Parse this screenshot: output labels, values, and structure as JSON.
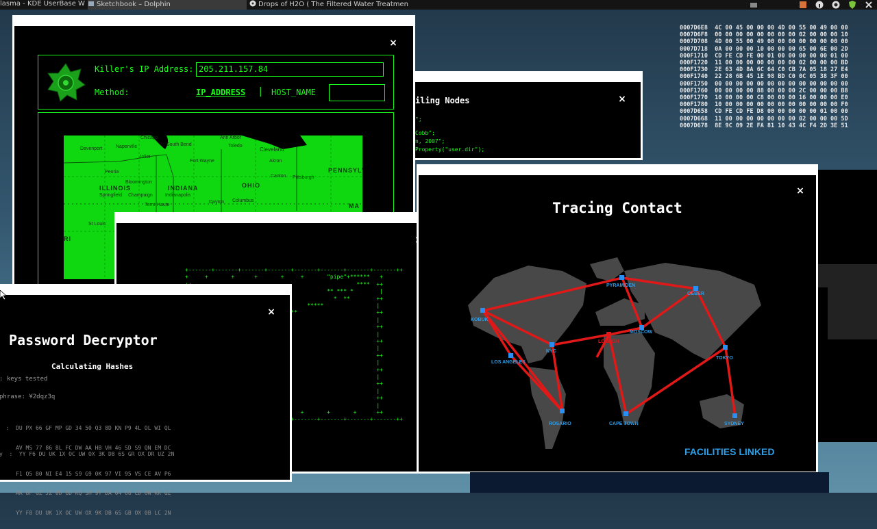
{
  "taskbar": {
    "tasks": [
      "lasma - KDE UserBase Wiki",
      "Sketchbook – Dolphin",
      "Drops of H2O ( The Filtered Water Treatment"
    ]
  },
  "hexdump": {
    "lines": [
      "0007D6E8  4C 00 45 00 00 00 4D 00 55 00 49 00 00",
      "0007D6F8  00 00 00 00 00 00 00 00 02 00 00 00 10",
      "0007D708  4D 00 55 00 49 00 00 00 00 00 00 00 00",
      "0007D718  0A 00 00 00 10 00 00 00 65 00 6E 00 2D",
      "000F1710  CD FE CD FE 00 01 00 00 00 00 00 01 00",
      "000F1720  11 00 00 00 00 00 00 00 02 00 00 00 BD",
      "000F1730  2E 63 4D 8A 6C 64 C0 CB 7A 05 18 27 E4",
      "000F1740  22 28 6B 45 1E 98 BD C0 0C 05 38 3F 00",
      "000F1750  00 00 00 00 00 00 00 00 00 00 00 00 00",
      "000F1760  00 00 00 00 88 00 00 00 2C 00 00 00 B8",
      "000F1770  10 00 00 00 C8 00 00 00 16 00 00 00 E0",
      "000F1780  10 00 00 00 00 00 00 00 00 00 00 00 F0",
      "0007D658  CD FE CD FE D8 00 00 00 00 00 01 00 00",
      "0007D668  11 00 00 00 00 00 00 00 02 00 00 00 5D",
      "0007D678  8E 9C 09 2E FA 81 10 43 4C F4 2D 3E 51"
    ]
  },
  "compile": {
    "title": "iling Nodes",
    "code": [
      "\";",
      "Cobb\";",
      "n, 2007\";",
      "Property(\"user.dir\");"
    ]
  },
  "ip_window": {
    "ip_label": "Killer's IP Address:",
    "ip_value": "205.211.157.84",
    "method_label": "Method:",
    "method_ip": "IP_ADDRESS",
    "method_sep": "|",
    "method_host": "HOST_NAME",
    "map": {
      "cities": [
        "Chicago",
        "Davenport",
        "Naperville",
        "Joliet",
        "South Bend",
        "Ann Arbor",
        "Toledo",
        "Cleveland",
        "Akron",
        "Canton",
        "Pittsburgh",
        "Fort Wayne",
        "Peoria",
        "Bloomington",
        "Champaign",
        "Springfield",
        "Indianapolis",
        "Terre Haute",
        "Columbus",
        "Dayton",
        "St Louis"
      ],
      "states": [
        "ILLINOIS",
        "INDIANA",
        "OHIO",
        "PENNSYLV",
        "MA",
        "RI"
      ]
    }
  },
  "pipe_window": {
    "lines": [
      "+-------+-------+-------+-------+-------+-------+-------+-------++",
      "+     +       +      +       +     +       \"pipe\"+******   +",
      "++                                                  ****  ++",
      "                                           ** *** *        |",
      "                                             *  **        ++",
      "                               *     *****                |",
      "                          ** *****                        ++",
      "                    ****                                  |",
      "                                                          ++",
      "                                                          |",
      "                                                          ++",
      "                                                          |",
      "                                                          ++",
      "                                                          |",
      "                                                          ++",
      "                                                          |",
      "                                                          ++",
      "                                                          |",
      "                                                          ++",
      "                                                          |",
      "+     +       +      +       +     +       +       +      ++",
      "+-------+-------+-------+-------+-------+-------+-------+-------++"
    ]
  },
  "trace_window": {
    "title": "Tracing Contact",
    "status": "FACILITIES LINKED",
    "nodes": [
      "KOBUK",
      "PYRAMIDEN",
      "OEBER",
      "NYC",
      "MOSCOW",
      "LONDON",
      "LOS ANGELES",
      "TOKYO",
      "ROSARIO",
      "CAPE TOWN",
      "SYDNEY"
    ],
    "colors": {
      "link": "#e01818",
      "node": "#2a8ff0",
      "label": "#2e9ee8",
      "land": "#484848"
    }
  },
  "password_window": {
    "title": "Password Decryptor",
    "subtitle": "Calculating Hashes",
    "keys_tested": ": keys tested",
    "passphrase": "phrase: ¥2dqz3q",
    "grid1": [
      "  :  DU PX 66 GF MP GD 34 50 Q3 8D KN P9 4L OL WI QL",
      "     AV MS 77 86 8L FC DW AA HB VH 46 SD S9 QN EM DC"
    ],
    "grid2": [
      "y  :  YY F6 DU UK 1X OC UW OX 3K D8 6S GR OX DR UZ 2N",
      "     F1 Q5 80 NI E4 15 S9 G9 0K 97 VI 95 VS CE AV P6",
      "     AR 8F GZ JZ 0D UD KQ SH 9Y DA 04 66 CD OW KK GZ",
      "     YY F8 DU UK 1X OC UW OX 9K DB 6S GB OX 0B LC 2N"
    ]
  }
}
